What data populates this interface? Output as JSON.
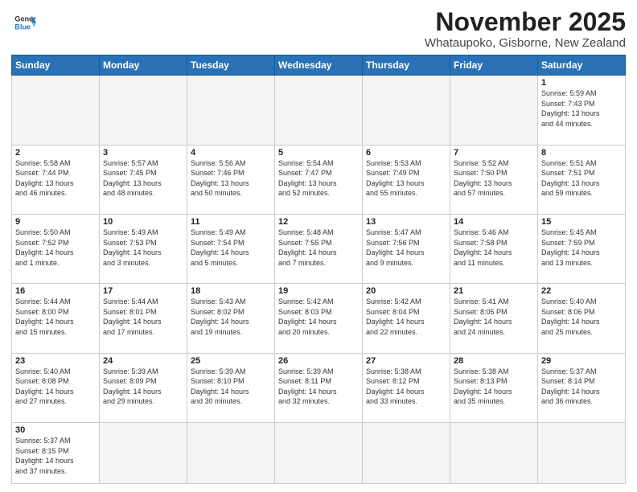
{
  "header": {
    "logo_general": "General",
    "logo_blue": "Blue",
    "month": "November 2025",
    "location": "Whataupoko, Gisborne, New Zealand"
  },
  "weekdays": [
    "Sunday",
    "Monday",
    "Tuesday",
    "Wednesday",
    "Thursday",
    "Friday",
    "Saturday"
  ],
  "weeks": [
    [
      {
        "day": "",
        "info": ""
      },
      {
        "day": "",
        "info": ""
      },
      {
        "day": "",
        "info": ""
      },
      {
        "day": "",
        "info": ""
      },
      {
        "day": "",
        "info": ""
      },
      {
        "day": "",
        "info": ""
      },
      {
        "day": "1",
        "info": "Sunrise: 5:59 AM\nSunset: 7:43 PM\nDaylight: 13 hours\nand 44 minutes."
      }
    ],
    [
      {
        "day": "2",
        "info": "Sunrise: 5:58 AM\nSunset: 7:44 PM\nDaylight: 13 hours\nand 46 minutes."
      },
      {
        "day": "3",
        "info": "Sunrise: 5:57 AM\nSunset: 7:45 PM\nDaylight: 13 hours\nand 48 minutes."
      },
      {
        "day": "4",
        "info": "Sunrise: 5:56 AM\nSunset: 7:46 PM\nDaylight: 13 hours\nand 50 minutes."
      },
      {
        "day": "5",
        "info": "Sunrise: 5:54 AM\nSunset: 7:47 PM\nDaylight: 13 hours\nand 52 minutes."
      },
      {
        "day": "6",
        "info": "Sunrise: 5:53 AM\nSunset: 7:49 PM\nDaylight: 13 hours\nand 55 minutes."
      },
      {
        "day": "7",
        "info": "Sunrise: 5:52 AM\nSunset: 7:50 PM\nDaylight: 13 hours\nand 57 minutes."
      },
      {
        "day": "8",
        "info": "Sunrise: 5:51 AM\nSunset: 7:51 PM\nDaylight: 13 hours\nand 59 minutes."
      }
    ],
    [
      {
        "day": "9",
        "info": "Sunrise: 5:50 AM\nSunset: 7:52 PM\nDaylight: 14 hours\nand 1 minute."
      },
      {
        "day": "10",
        "info": "Sunrise: 5:49 AM\nSunset: 7:53 PM\nDaylight: 14 hours\nand 3 minutes."
      },
      {
        "day": "11",
        "info": "Sunrise: 5:49 AM\nSunset: 7:54 PM\nDaylight: 14 hours\nand 5 minutes."
      },
      {
        "day": "12",
        "info": "Sunrise: 5:48 AM\nSunset: 7:55 PM\nDaylight: 14 hours\nand 7 minutes."
      },
      {
        "day": "13",
        "info": "Sunrise: 5:47 AM\nSunset: 7:56 PM\nDaylight: 14 hours\nand 9 minutes."
      },
      {
        "day": "14",
        "info": "Sunrise: 5:46 AM\nSunset: 7:58 PM\nDaylight: 14 hours\nand 11 minutes."
      },
      {
        "day": "15",
        "info": "Sunrise: 5:45 AM\nSunset: 7:59 PM\nDaylight: 14 hours\nand 13 minutes."
      }
    ],
    [
      {
        "day": "16",
        "info": "Sunrise: 5:44 AM\nSunset: 8:00 PM\nDaylight: 14 hours\nand 15 minutes."
      },
      {
        "day": "17",
        "info": "Sunrise: 5:44 AM\nSunset: 8:01 PM\nDaylight: 14 hours\nand 17 minutes."
      },
      {
        "day": "18",
        "info": "Sunrise: 5:43 AM\nSunset: 8:02 PM\nDaylight: 14 hours\nand 19 minutes."
      },
      {
        "day": "19",
        "info": "Sunrise: 5:42 AM\nSunset: 8:03 PM\nDaylight: 14 hours\nand 20 minutes."
      },
      {
        "day": "20",
        "info": "Sunrise: 5:42 AM\nSunset: 8:04 PM\nDaylight: 14 hours\nand 22 minutes."
      },
      {
        "day": "21",
        "info": "Sunrise: 5:41 AM\nSunset: 8:05 PM\nDaylight: 14 hours\nand 24 minutes."
      },
      {
        "day": "22",
        "info": "Sunrise: 5:40 AM\nSunset: 8:06 PM\nDaylight: 14 hours\nand 25 minutes."
      }
    ],
    [
      {
        "day": "23",
        "info": "Sunrise: 5:40 AM\nSunset: 8:08 PM\nDaylight: 14 hours\nand 27 minutes."
      },
      {
        "day": "24",
        "info": "Sunrise: 5:39 AM\nSunset: 8:09 PM\nDaylight: 14 hours\nand 29 minutes."
      },
      {
        "day": "25",
        "info": "Sunrise: 5:39 AM\nSunset: 8:10 PM\nDaylight: 14 hours\nand 30 minutes."
      },
      {
        "day": "26",
        "info": "Sunrise: 5:39 AM\nSunset: 8:11 PM\nDaylight: 14 hours\nand 32 minutes."
      },
      {
        "day": "27",
        "info": "Sunrise: 5:38 AM\nSunset: 8:12 PM\nDaylight: 14 hours\nand 33 minutes."
      },
      {
        "day": "28",
        "info": "Sunrise: 5:38 AM\nSunset: 8:13 PM\nDaylight: 14 hours\nand 35 minutes."
      },
      {
        "day": "29",
        "info": "Sunrise: 5:37 AM\nSunset: 8:14 PM\nDaylight: 14 hours\nand 36 minutes."
      }
    ],
    [
      {
        "day": "30",
        "info": "Sunrise: 5:37 AM\nSunset: 8:15 PM\nDaylight: 14 hours\nand 37 minutes."
      },
      {
        "day": "",
        "info": ""
      },
      {
        "day": "",
        "info": ""
      },
      {
        "day": "",
        "info": ""
      },
      {
        "day": "",
        "info": ""
      },
      {
        "day": "",
        "info": ""
      },
      {
        "day": "",
        "info": ""
      }
    ]
  ]
}
